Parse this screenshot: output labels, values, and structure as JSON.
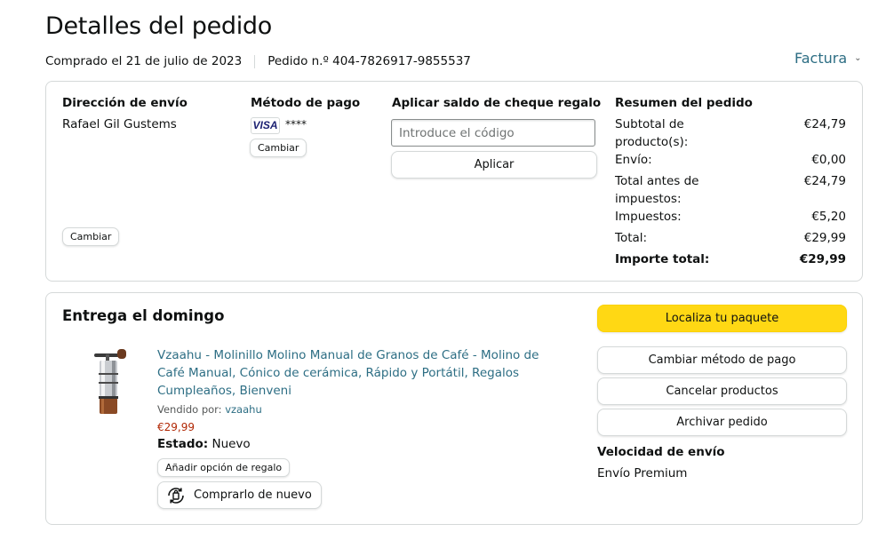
{
  "header": {
    "title": "Detalles del pedido",
    "purchased": "Comprado el 21 de julio de 2023",
    "order_number": "Pedido n.º 404-7826917-9855537",
    "invoice_label": "Factura"
  },
  "summary_box": {
    "shipping": {
      "heading": "Dirección de envío",
      "name": "Rafael Gil Gustems",
      "change_label": "Cambiar"
    },
    "payment": {
      "heading": "Método de pago",
      "card_brand": "VISA",
      "card_mask": "****",
      "change_label": "Cambiar"
    },
    "gift_card": {
      "heading": "Aplicar saldo de cheque regalo",
      "placeholder": "Introduce el código",
      "apply_label": "Aplicar"
    },
    "order_summary": {
      "heading": "Resumen del pedido",
      "rows": [
        {
          "label": "Subtotal de producto(s):",
          "value": "€24,79"
        },
        {
          "label": "Envío:",
          "value": "€0,00"
        },
        {
          "label": "Total antes de impuestos:",
          "value": "€24,79"
        },
        {
          "label": "Impuestos:",
          "value": "€5,20"
        },
        {
          "label": "Total:",
          "value": "€29,99"
        },
        {
          "label": "Importe total:",
          "value": "€29,99"
        }
      ]
    }
  },
  "delivery": {
    "title": "Entrega el domingo",
    "product": {
      "title": "Vzaahu - Molinillo Molino Manual de Granos de Café - Molino de Café Manual, Cónico de cerámica, Rápido y Portátil, Regalos Cumpleaños, Bienveni",
      "sold_by_label": "Vendido por:",
      "seller": "vzaahu",
      "price": "€29,99",
      "status_label": "Estado:",
      "status_value": "Nuevo",
      "gift_option_label": "Añadir opción de regalo",
      "buy_again_label": "Comprarlo de nuevo"
    },
    "actions": {
      "track": "Localiza tu paquete",
      "change_payment": "Cambiar método de pago",
      "cancel": "Cancelar productos",
      "archive": "Archivar pedido"
    },
    "speed": {
      "heading": "Velocidad de envío",
      "value": "Envío Premium"
    }
  },
  "colors": {
    "link": "#2d6e84",
    "price": "#b12704",
    "primary_button": "#ffd814",
    "border": "#d5d9d9"
  }
}
